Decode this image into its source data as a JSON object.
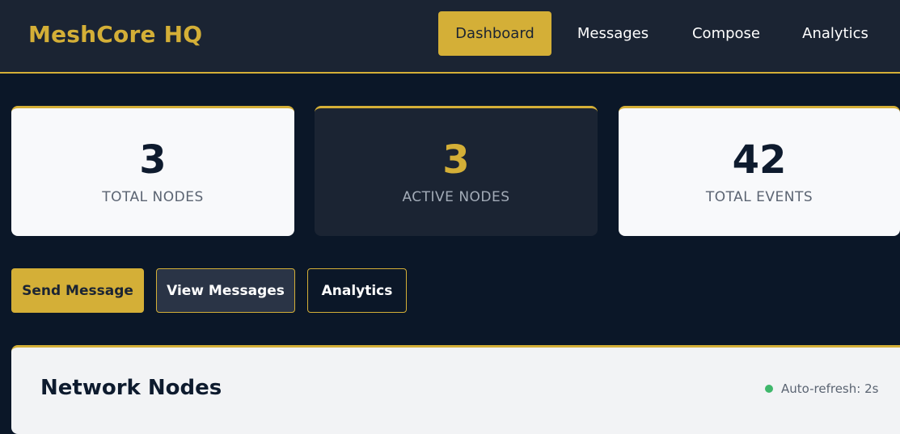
{
  "header": {
    "brand": "MeshCore HQ",
    "nav": [
      {
        "label": "Dashboard",
        "active": true
      },
      {
        "label": "Messages",
        "active": false
      },
      {
        "label": "Compose",
        "active": false
      },
      {
        "label": "Analytics",
        "active": false
      }
    ]
  },
  "stats": [
    {
      "value": "3",
      "label": "TOTAL NODES"
    },
    {
      "value": "3",
      "label": "ACTIVE NODES"
    },
    {
      "value": "42",
      "label": "TOTAL EVENTS"
    }
  ],
  "actions": {
    "send": "Send Message",
    "view": "View Messages",
    "analytics": "Analytics"
  },
  "nodes_panel": {
    "title": "Network Nodes",
    "refresh": "Auto-refresh: 2s",
    "refresh_status_color": "#3fb76b"
  },
  "colors": {
    "accent": "#d4af37",
    "background": "#0b1728",
    "header": "#1b2433"
  }
}
